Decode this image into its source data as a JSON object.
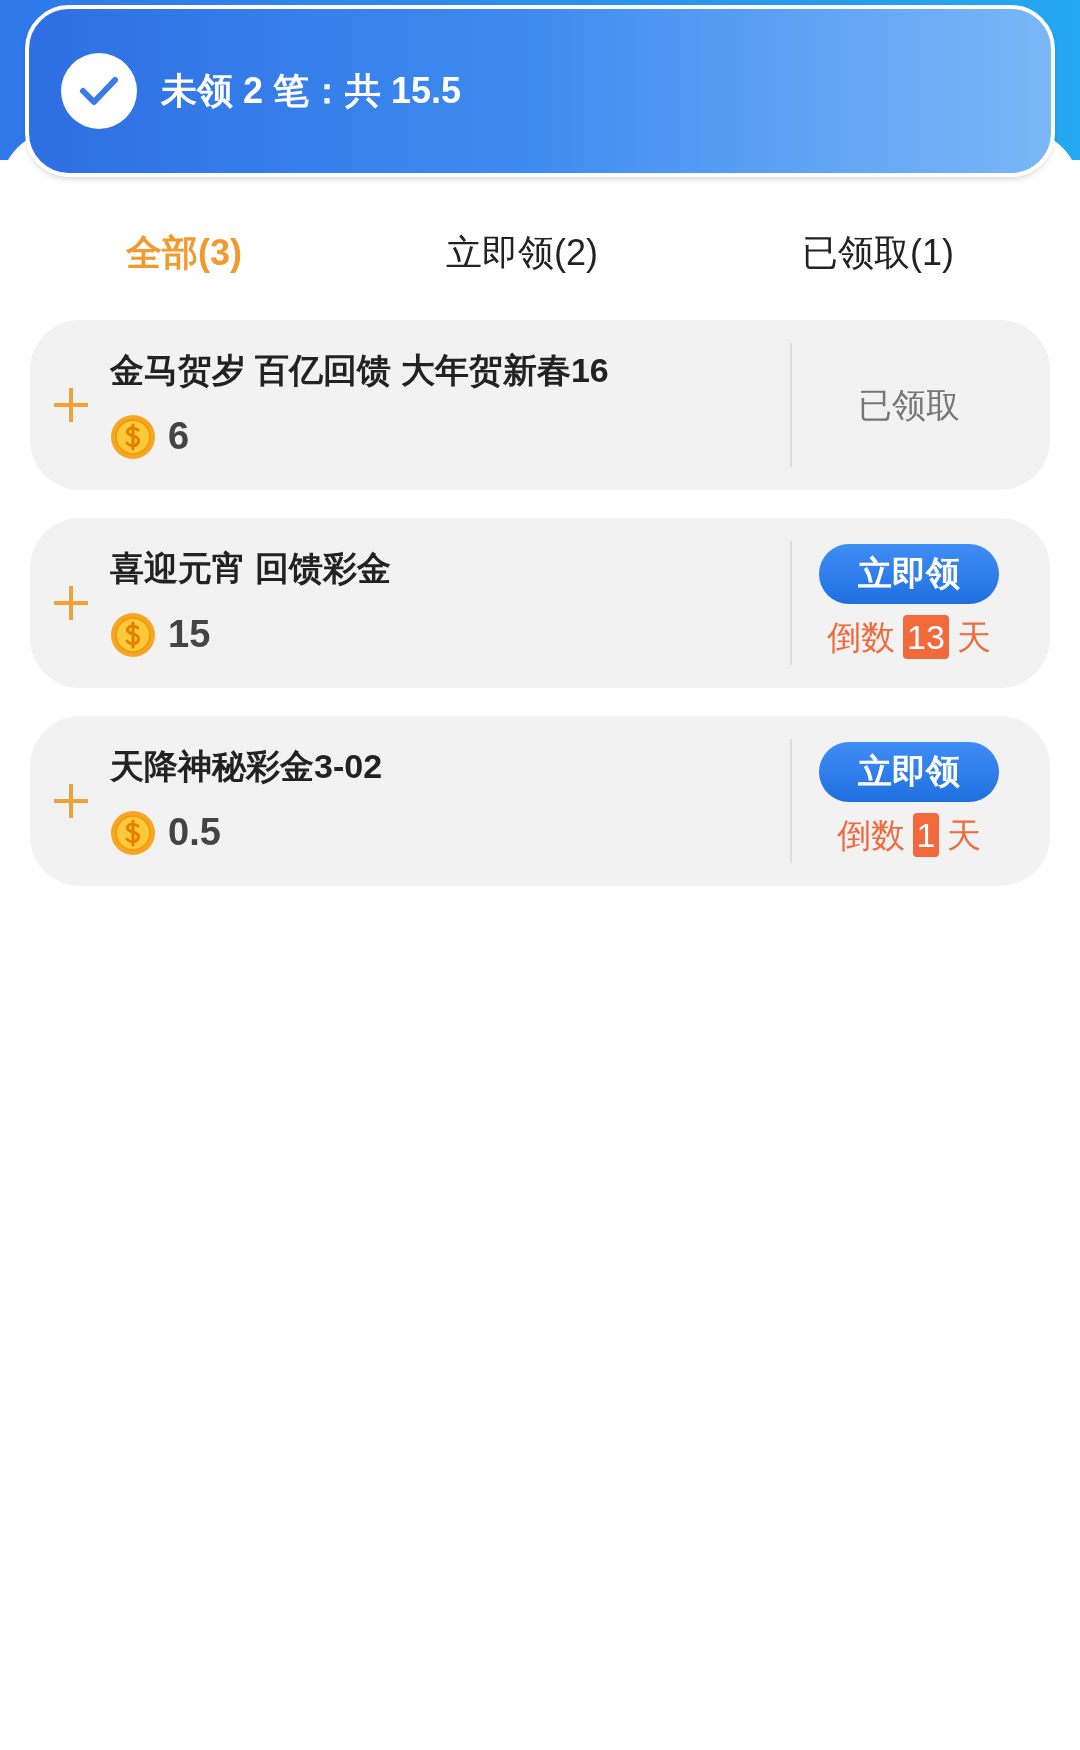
{
  "summary": {
    "text": "未领 2 笔：共 15.5"
  },
  "tabs": [
    {
      "label": "全部(3)",
      "selected": true
    },
    {
      "label": "立即领(2)",
      "selected": false
    },
    {
      "label": "已领取(1)",
      "selected": false
    }
  ],
  "rewards": [
    {
      "title": "金马贺岁 百亿回馈 大年贺新春16",
      "amount": "6",
      "kind": "claimed",
      "status": "已领取"
    },
    {
      "title": "喜迎元宵 回馈彩金",
      "amount": "15",
      "kind": "claimable",
      "button": "立即领",
      "countdown": {
        "prefix": "倒数",
        "days": "13",
        "suffix": "天"
      }
    },
    {
      "title": "天降神秘彩金3-02",
      "amount": "0.5",
      "kind": "claimable",
      "button": "立即领",
      "countdown": {
        "prefix": "倒数",
        "days": "1",
        "suffix": "天"
      }
    }
  ]
}
